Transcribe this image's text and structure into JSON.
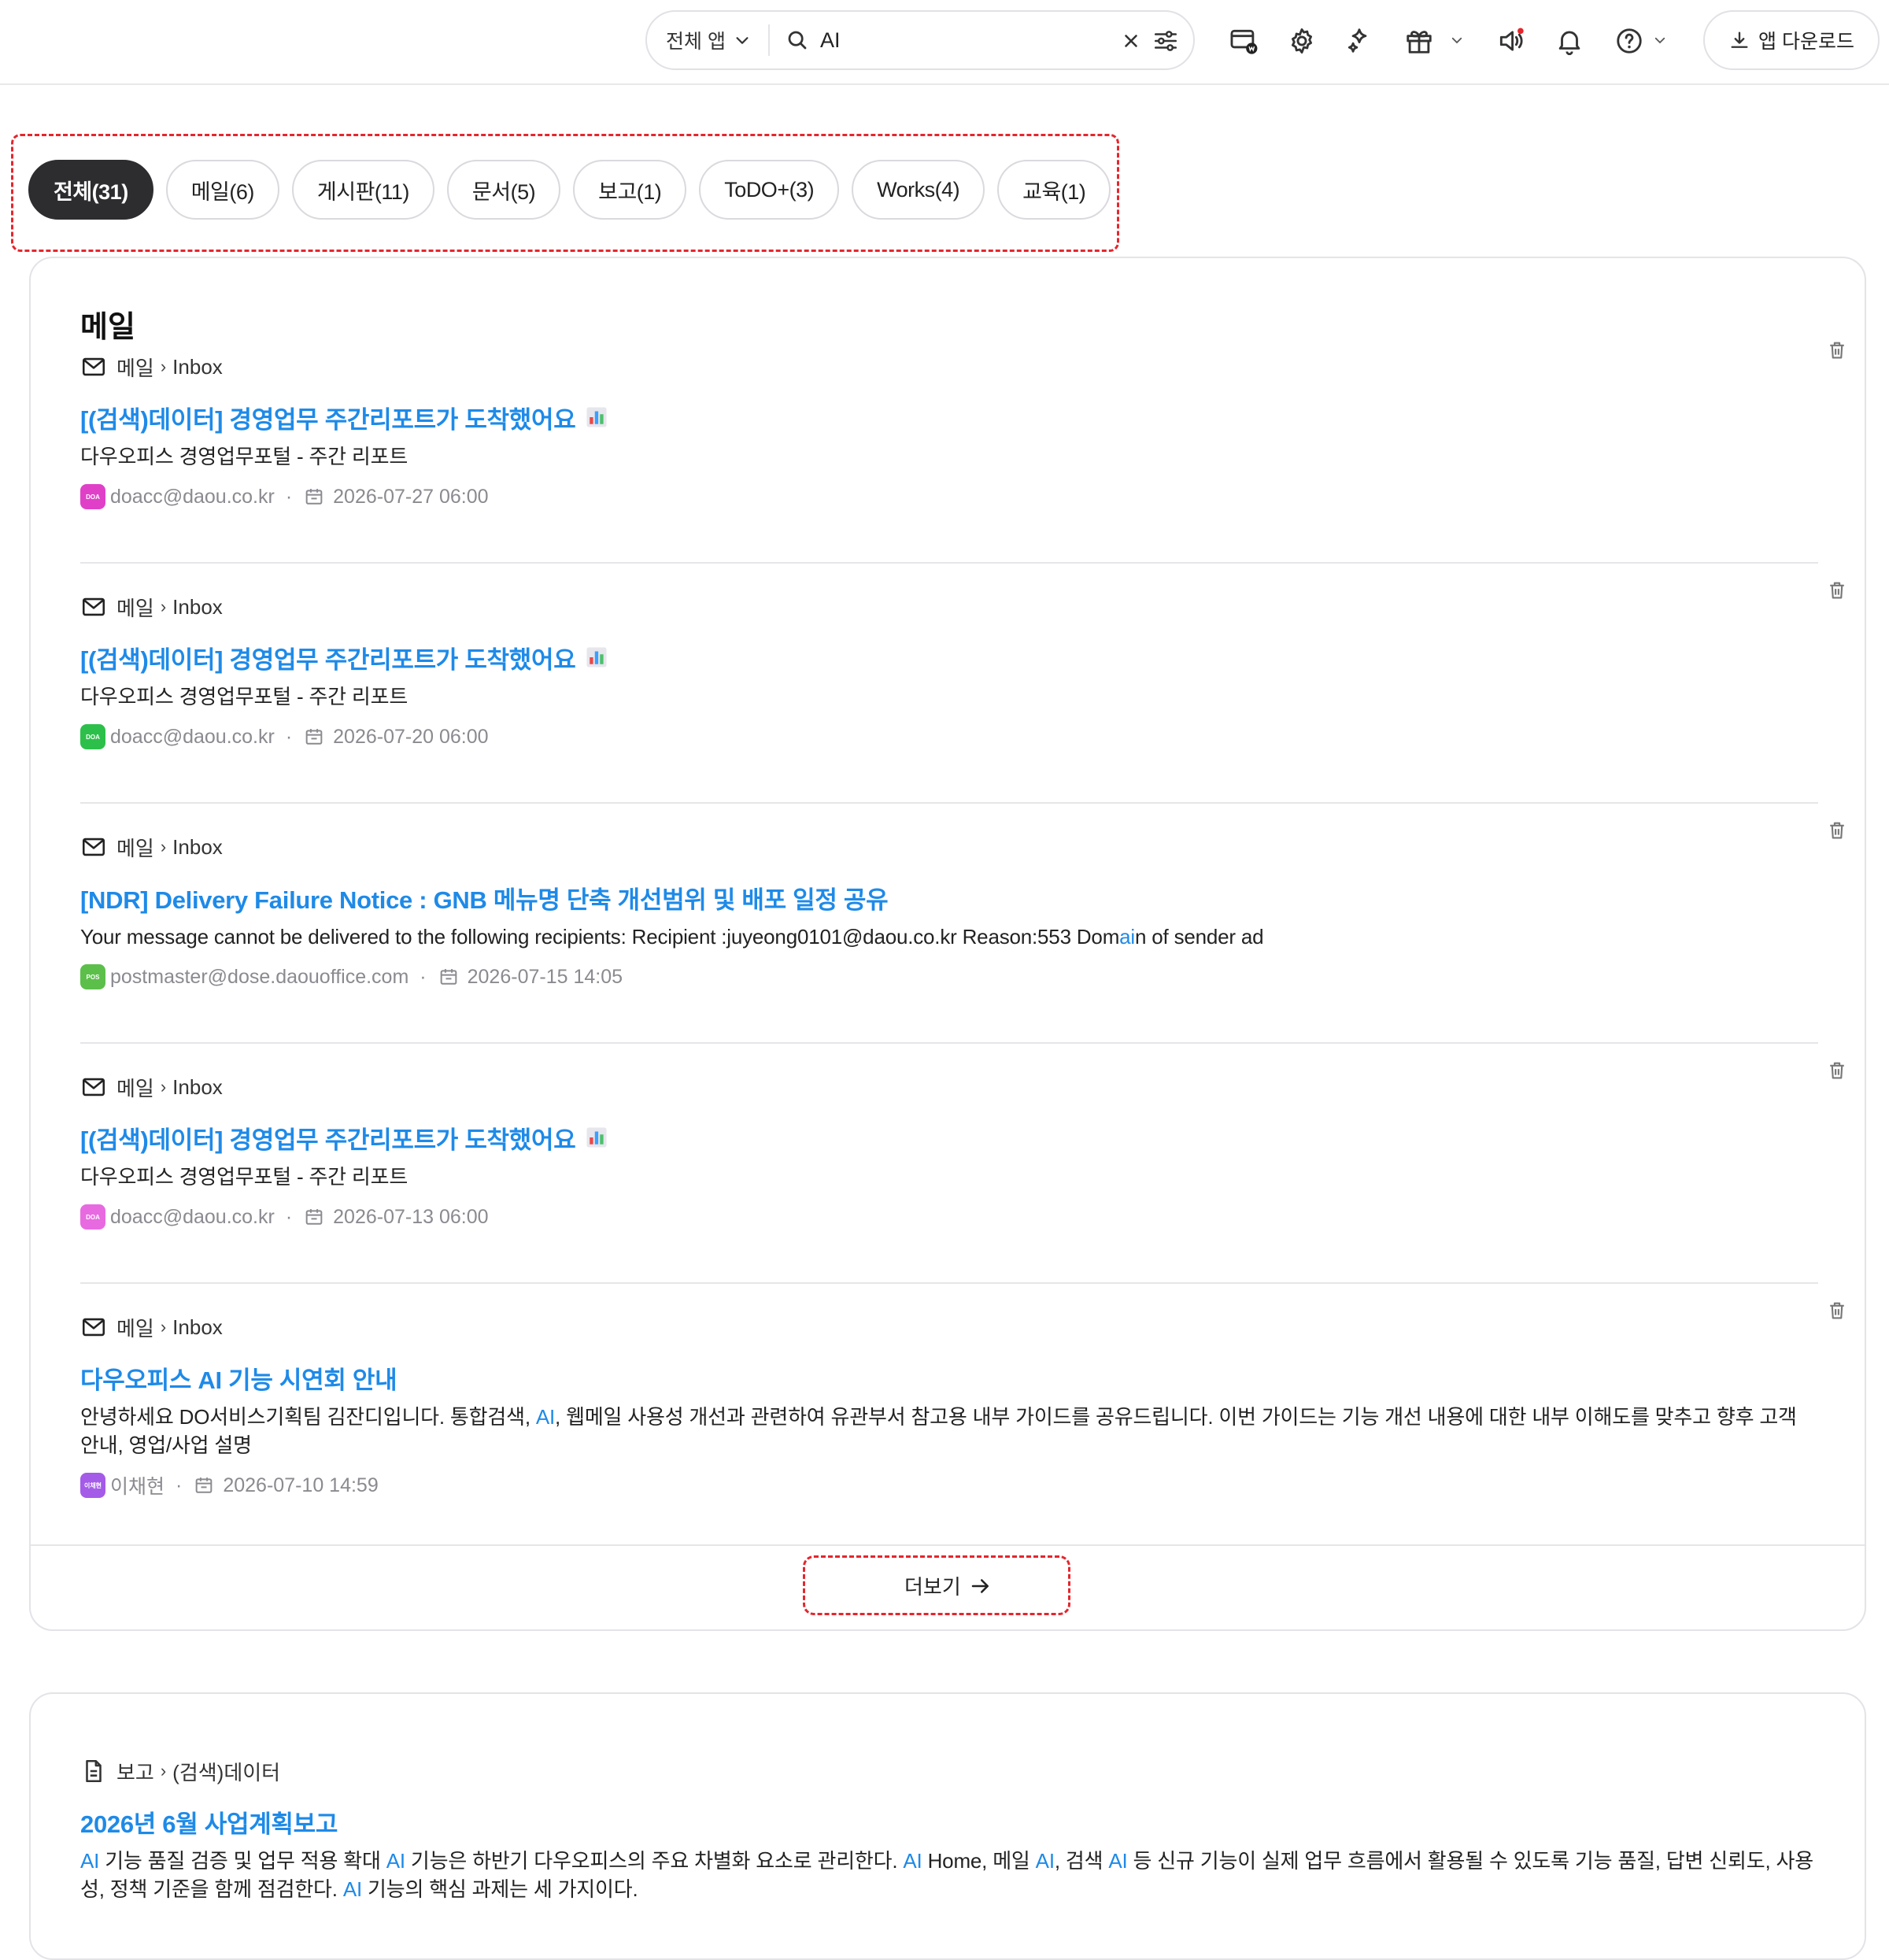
{
  "search": {
    "scope_label": "전체 앱",
    "query": "AI"
  },
  "header": {
    "app_download_label": "앱 다운로드"
  },
  "filters": [
    {
      "label": "전체(31)",
      "active": true
    },
    {
      "label": "메일(6)",
      "active": false
    },
    {
      "label": "게시판(11)",
      "active": false
    },
    {
      "label": "문서(5)",
      "active": false
    },
    {
      "label": "보고(1)",
      "active": false
    },
    {
      "label": "ToDO+(3)",
      "active": false
    },
    {
      "label": "Works(4)",
      "active": false
    },
    {
      "label": "교육(1)",
      "active": false
    }
  ],
  "mail_section": {
    "title": "메일",
    "more_label": "더보기",
    "items": [
      {
        "crumb_app": "메일",
        "crumb_folder": "Inbox",
        "subject": "[(검색)데이터] 경영업무 주간리포트가 도착했어요",
        "preview": "다우오피스 경영업무포털 - 주간 리포트",
        "sender": "doacc@daou.co.kr",
        "avatar_text": "DOA",
        "avatar_color": "#e040c8",
        "date": "2026-07-27 06:00"
      },
      {
        "crumb_app": "메일",
        "crumb_folder": "Inbox",
        "subject": "[(검색)데이터] 경영업무 주간리포트가 도착했어요",
        "preview": "다우오피스 경영업무포털 - 주간 리포트",
        "sender": "doacc@daou.co.kr",
        "avatar_text": "DOA",
        "avatar_color": "#2cc04a",
        "date": "2026-07-20 06:00"
      },
      {
        "crumb_app": "메일",
        "crumb_folder": "Inbox",
        "subject": "[NDR] Delivery Failure Notice : GNB 메뉴명 단축 개선범위 및 배포 일정 공유",
        "preview_pre": "Your message cannot be delivered to the following recipients: Recipient :juyeong0101@daou.co.kr Reason:553 Dom",
        "preview_hl": "ai",
        "preview_post": "n of sender ad",
        "sender": "postmaster@dose.daouoffice.com",
        "avatar_text": "POS",
        "avatar_color": "#5cbf4a",
        "date": "2026-07-15 14:05"
      },
      {
        "crumb_app": "메일",
        "crumb_folder": "Inbox",
        "subject": "[(검색)데이터] 경영업무 주간리포트가 도착했어요",
        "preview": "다우오피스 경영업무포털 - 주간 리포트",
        "sender": "doacc@daou.co.kr",
        "avatar_text": "DOA",
        "avatar_color": "#e86ae0",
        "date": "2026-07-13 06:00"
      },
      {
        "crumb_app": "메일",
        "crumb_folder": "Inbox",
        "subject": "다우오피스 AI 기능 시연회 안내",
        "preview_pre": "안녕하세요 DO서비스기획팀 김잔디입니다. 통합검색, ",
        "preview_hl": "AI",
        "preview_post": ", 웹메일 사용성 개선과 관련하여 유관부서 참고용 내부 가이드를 공유드립니다. 이번 가이드는 기능 개선 내용에 대한 내부 이해도를 맞추고 향후 고객 안내, 영업/사업 설명",
        "sender": "이채현",
        "avatar_text": "이채현",
        "avatar_color": "#a45be8",
        "date": "2026-07-10 14:59"
      }
    ]
  },
  "report_section": {
    "crumb_app": "보고",
    "crumb_folder": "(검색)데이터",
    "subject": "2026년 6월 사업계획보고",
    "preview_parts": [
      {
        "t": "AI",
        "hl": true
      },
      {
        "t": " 기능 품질 검증 및 업무 적용 확대 ",
        "hl": false
      },
      {
        "t": "AI",
        "hl": true
      },
      {
        "t": " 기능은 하반기 다우오피스의 주요 차별화 요소로 관리한다. ",
        "hl": false
      },
      {
        "t": "AI",
        "hl": true
      },
      {
        "t": " Home, 메일 ",
        "hl": false
      },
      {
        "t": "AI",
        "hl": true
      },
      {
        "t": ", 검색 ",
        "hl": false
      },
      {
        "t": "AI",
        "hl": true
      },
      {
        "t": " 등 신규 기능이 실제 업무 흐름에서 활용될 수 있도록 기능 품질, 답변 신뢰도, 사용성, 정책 기준을 함께 점검한다. ",
        "hl": false
      },
      {
        "t": "AI",
        "hl": true
      },
      {
        "t": " 기능의 핵심 과제는 세 가지이다.",
        "hl": false
      }
    ]
  },
  "colors": {
    "accent": "#1e8ae8",
    "highlight_border": "#e5262d",
    "active_pill": "#2d2d30"
  }
}
